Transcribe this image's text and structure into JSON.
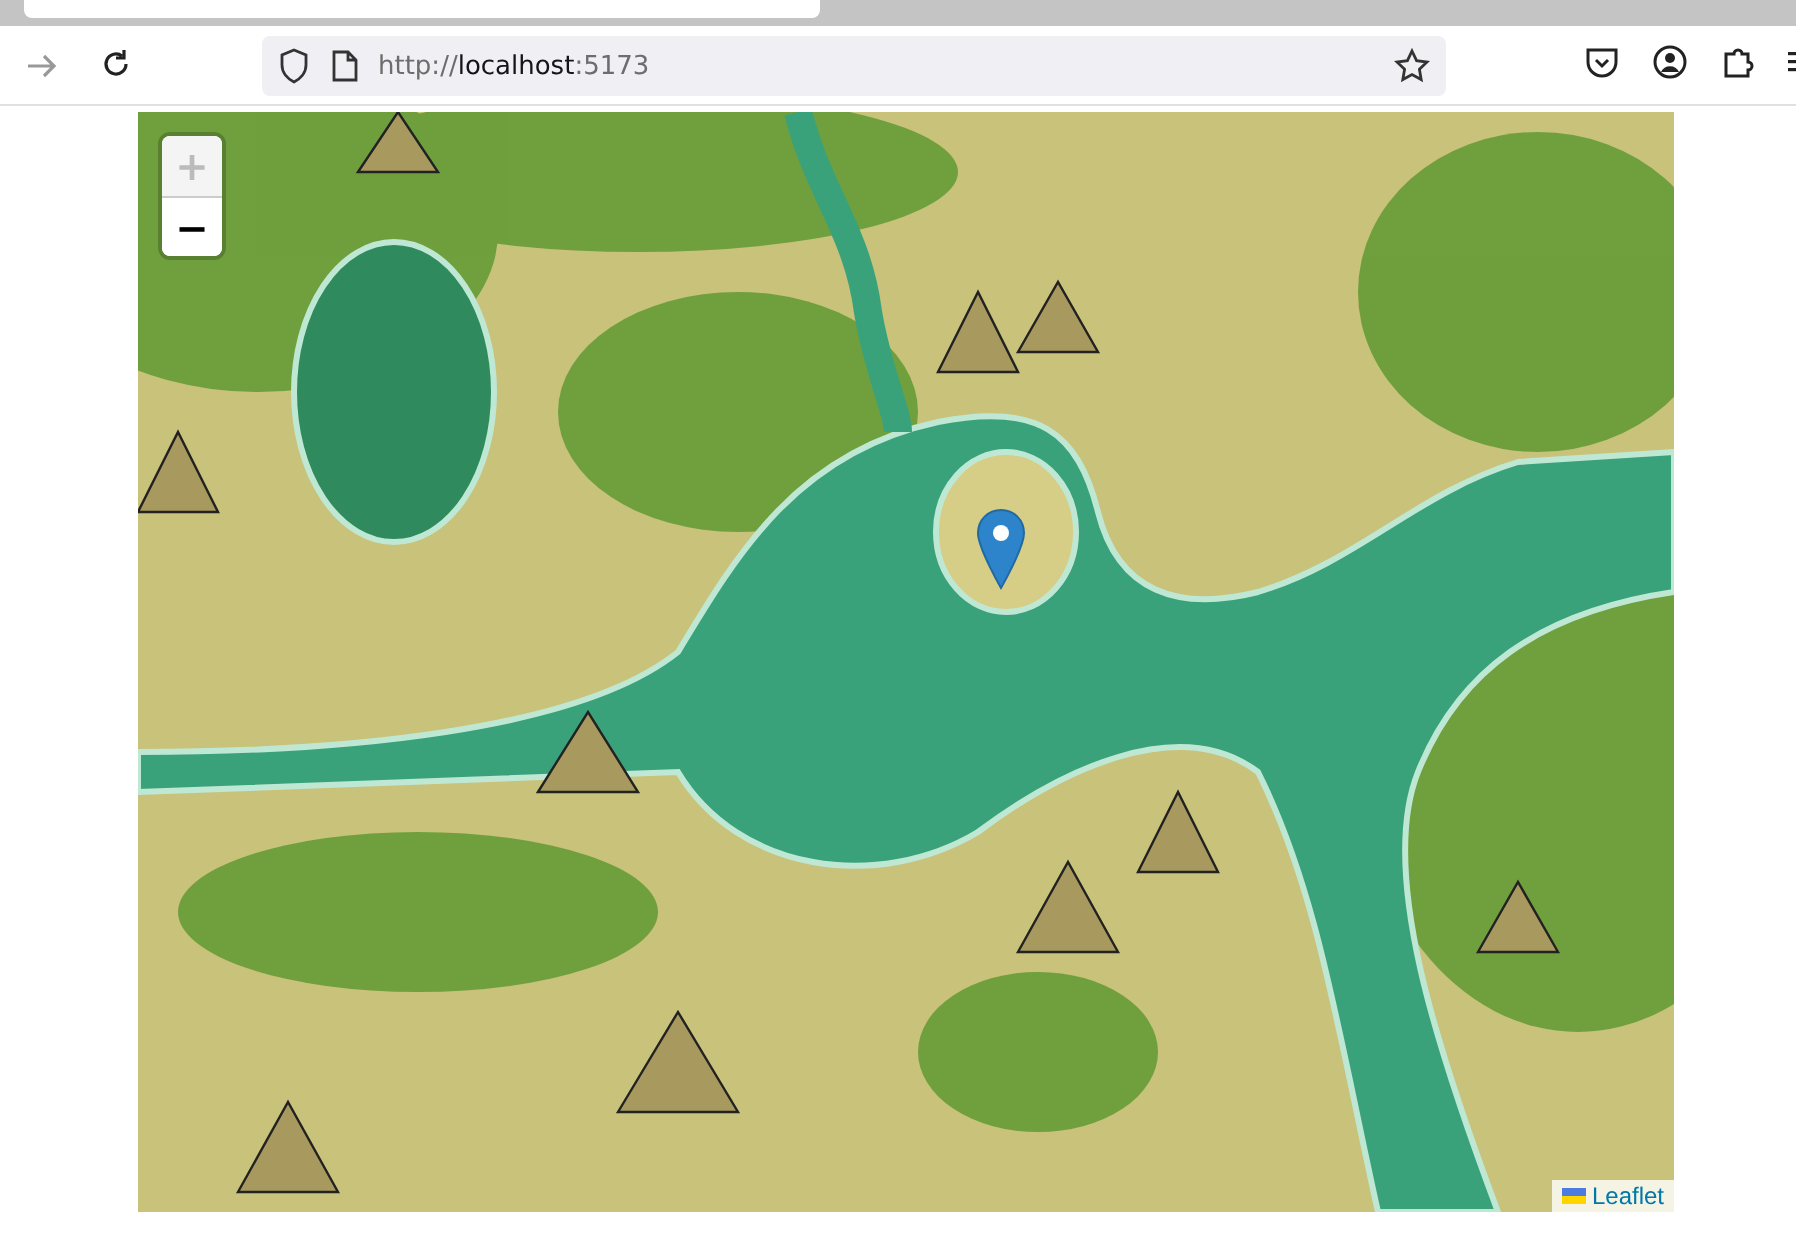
{
  "browser": {
    "url": {
      "scheme": "http://",
      "host": "localhost",
      "port": ":5173"
    }
  },
  "map": {
    "zoom_controls": [
      {
        "label": "+",
        "disabled": true
      },
      {
        "label": "−",
        "disabled": false
      }
    ],
    "attribution": {
      "link": "Leaflet"
    }
  }
}
